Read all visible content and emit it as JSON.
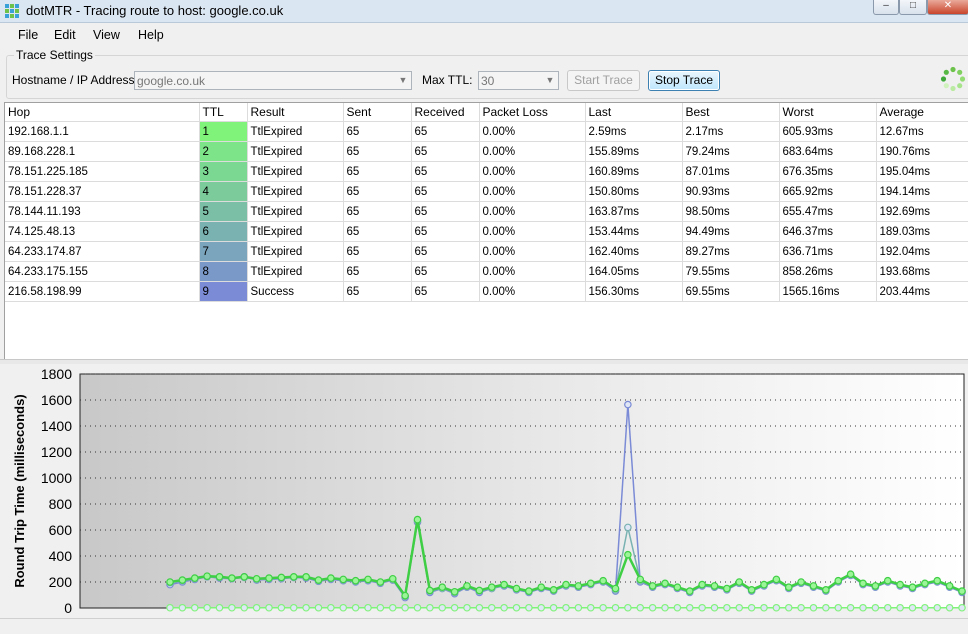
{
  "window": {
    "title": "dotMTR - Tracing route to host: google.co.uk",
    "minimize_glyph": "–",
    "maximize_glyph": "□",
    "close_glyph": "✕"
  },
  "menu": {
    "file": "File",
    "edit": "Edit",
    "view": "View",
    "help": "Help"
  },
  "settings": {
    "group_label": "Trace Settings",
    "hostname_label": "Hostname / IP Address:",
    "hostname_value": "google.co.uk",
    "maxttl_label": "Max TTL:",
    "maxttl_value": "30",
    "start_label": "Start Trace",
    "stop_label": "Stop Trace"
  },
  "table": {
    "columns": [
      "Hop",
      "TTL",
      "Result",
      "Sent",
      "Received",
      "Packet Loss",
      "Last",
      "Best",
      "Worst",
      "Average"
    ],
    "ttl_colors": [
      "#80f37a",
      "#7ee48a",
      "#7ad892",
      "#7ccb9b",
      "#7abfa6",
      "#7ab2b2",
      "#7aa5bc",
      "#7a99c8",
      "#7b8bd6"
    ],
    "rows": [
      [
        "192.168.1.1",
        "1",
        "TtlExpired",
        "65",
        "65",
        "0.00%",
        "2.59ms",
        "2.17ms",
        "605.93ms",
        "12.67ms"
      ],
      [
        "89.168.228.1",
        "2",
        "TtlExpired",
        "65",
        "65",
        "0.00%",
        "155.89ms",
        "79.24ms",
        "683.64ms",
        "190.76ms"
      ],
      [
        "78.151.225.185",
        "3",
        "TtlExpired",
        "65",
        "65",
        "0.00%",
        "160.89ms",
        "87.01ms",
        "676.35ms",
        "195.04ms"
      ],
      [
        "78.151.228.37",
        "4",
        "TtlExpired",
        "65",
        "65",
        "0.00%",
        "150.80ms",
        "90.93ms",
        "665.92ms",
        "194.14ms"
      ],
      [
        "78.144.11.193",
        "5",
        "TtlExpired",
        "65",
        "65",
        "0.00%",
        "163.87ms",
        "98.50ms",
        "655.47ms",
        "192.69ms"
      ],
      [
        "74.125.48.13",
        "6",
        "TtlExpired",
        "65",
        "65",
        "0.00%",
        "153.44ms",
        "94.49ms",
        "646.37ms",
        "189.03ms"
      ],
      [
        "64.233.174.87",
        "7",
        "TtlExpired",
        "65",
        "65",
        "0.00%",
        "162.40ms",
        "89.27ms",
        "636.71ms",
        "192.04ms"
      ],
      [
        "64.233.175.155",
        "8",
        "TtlExpired",
        "65",
        "65",
        "0.00%",
        "164.05ms",
        "79.55ms",
        "858.26ms",
        "193.68ms"
      ],
      [
        "216.58.198.99",
        "9",
        "Success",
        "65",
        "65",
        "0.00%",
        "156.30ms",
        "69.55ms",
        "1565.16ms",
        "203.44ms"
      ]
    ]
  },
  "chart_data": {
    "type": "line",
    "ylabel": "Round Trip Time (milliseconds)",
    "ylim": [
      0,
      1800
    ],
    "yticks": [
      0,
      200,
      400,
      600,
      800,
      1000,
      1200,
      1400,
      1600,
      1800
    ],
    "grid": "dotted horizontal",
    "series": [
      {
        "color": "#80f37a",
        "values": [
          2,
          2,
          2,
          2,
          2,
          2,
          2,
          2,
          2,
          2,
          2,
          2,
          2,
          2,
          2,
          2,
          2,
          2,
          2,
          2,
          2,
          2,
          2,
          2,
          2,
          2,
          2,
          2,
          2,
          2,
          2,
          2,
          2,
          2,
          2,
          2,
          2,
          2,
          2,
          2,
          2,
          2,
          2,
          2,
          2,
          2,
          2,
          2,
          2,
          2,
          2,
          2,
          2,
          2,
          2,
          2,
          2,
          2,
          2,
          2,
          2,
          2,
          2,
          2,
          2
        ]
      },
      {
        "color": "#7b8bd6",
        "values": [
          180,
          200,
          220,
          240,
          230,
          225,
          240,
          215,
          220,
          225,
          235,
          230,
          205,
          220,
          210,
          200,
          210,
          190,
          215,
          80,
          660,
          120,
          150,
          110,
          160,
          120,
          150,
          170,
          140,
          120,
          150,
          130,
          170,
          160,
          180,
          200,
          130,
          1565,
          200,
          160,
          180,
          150,
          120,
          170,
          160,
          140,
          190,
          130,
          170,
          210,
          150,
          190,
          160,
          130,
          200,
          250,
          180,
          160,
          200,
          170,
          150,
          180,
          200,
          160,
          120
        ]
      },
      {
        "color": "#7ab2b2",
        "values": [
          195,
          210,
          225,
          240,
          235,
          225,
          235,
          220,
          225,
          230,
          235,
          235,
          210,
          225,
          215,
          205,
          215,
          195,
          220,
          90,
          670,
          130,
          150,
          120,
          165,
          130,
          150,
          175,
          145,
          125,
          155,
          135,
          175,
          165,
          185,
          205,
          140,
          620,
          210,
          165,
          185,
          155,
          125,
          175,
          165,
          145,
          195,
          135,
          175,
          215,
          155,
          195,
          165,
          135,
          205,
          255,
          185,
          165,
          205,
          175,
          155,
          185,
          205,
          165,
          125
        ]
      },
      {
        "color": "#3fcf45",
        "values": [
          200,
          215,
          230,
          245,
          240,
          230,
          240,
          225,
          230,
          235,
          240,
          240,
          215,
          230,
          220,
          210,
          220,
          200,
          225,
          95,
          680,
          135,
          160,
          125,
          170,
          135,
          160,
          180,
          150,
          130,
          160,
          140,
          180,
          170,
          190,
          210,
          150,
          410,
          220,
          170,
          190,
          160,
          130,
          180,
          170,
          150,
          200,
          140,
          180,
          220,
          160,
          200,
          170,
          140,
          210,
          260,
          190,
          170,
          210,
          180,
          160,
          190,
          210,
          170,
          130
        ]
      }
    ]
  }
}
